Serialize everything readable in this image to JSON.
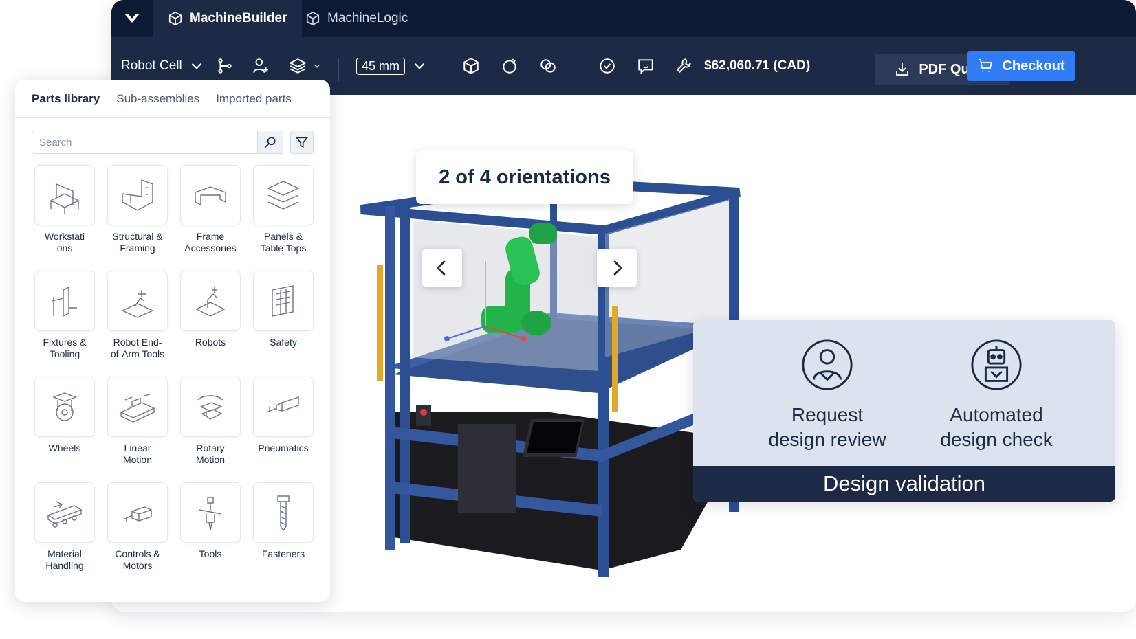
{
  "app": {
    "tabs": [
      {
        "label": "MachineBuilder",
        "icon": "cube-icon",
        "active": true
      },
      {
        "label": "MachineLogic",
        "icon": "cube-icon",
        "active": false
      }
    ]
  },
  "toolbar": {
    "cell_select": "Robot Cell",
    "mm_value": "45 mm",
    "price": "$62,060.71 (CAD)",
    "pdf_label": "PDF Quote",
    "checkout_label": "Checkout"
  },
  "colors": {
    "topbar": "#0d1a33",
    "toolbar": "#1c2a45",
    "accent": "#2f7cf6",
    "frame": "#2c4e93",
    "robot": "#22b34b"
  },
  "panel": {
    "tabs": [
      "Parts library",
      "Sub-assemblies",
      "Imported parts"
    ],
    "search_placeholder": "Search",
    "categories": [
      {
        "label": "Workstati\nons",
        "icon": "workstation-icon"
      },
      {
        "label": "Structural &\nFraming",
        "icon": "framing-icon"
      },
      {
        "label": "Frame\nAccessories",
        "icon": "frame-accessory-icon"
      },
      {
        "label": "Panels &\nTable Tops",
        "icon": "panels-icon"
      },
      {
        "label": "Fixtures &\nTooling",
        "icon": "fixtures-icon"
      },
      {
        "label": "Robot End-\nof-Arm Tools",
        "icon": "end-effector-icon"
      },
      {
        "label": "Robots",
        "icon": "robot-arm-icon"
      },
      {
        "label": "Safety",
        "icon": "safety-icon"
      },
      {
        "label": "Wheels",
        "icon": "wheel-icon"
      },
      {
        "label": "Linear\nMotion",
        "icon": "linear-motion-icon"
      },
      {
        "label": "Rotary\nMotion",
        "icon": "rotary-motion-icon"
      },
      {
        "label": "Pneumatics",
        "icon": "pneumatics-icon"
      },
      {
        "label": "Material\nHandling",
        "icon": "conveyor-icon"
      },
      {
        "label": "Controls &\nMotors",
        "icon": "motor-icon"
      },
      {
        "label": "Tools",
        "icon": "tool-icon"
      },
      {
        "label": "Fasteners",
        "icon": "bolt-icon"
      }
    ]
  },
  "viewer": {
    "orientation_label": "2 of 4 orientations"
  },
  "validation": {
    "review_label_1": "Request",
    "review_label_2": "design review",
    "check_label_1": "Automated",
    "check_label_2": "design check",
    "footer": "Design validation"
  }
}
